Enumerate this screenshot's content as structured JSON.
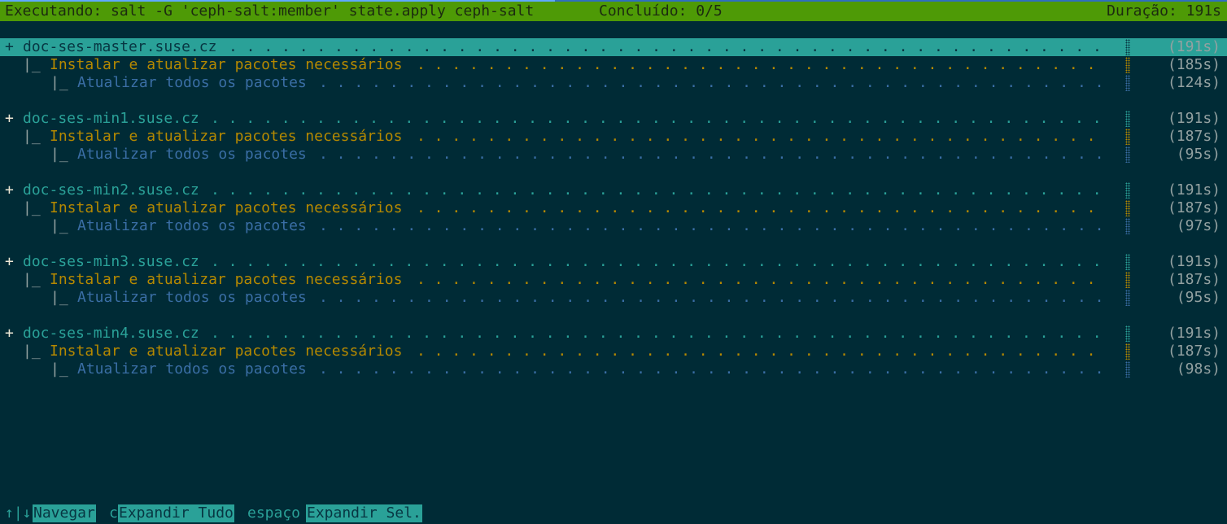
{
  "header": {
    "command": "Executando: salt -G 'ceph-salt:member' state.apply ceph-salt",
    "completed": "Concluído: 0/5",
    "duration": "Duração: 191s"
  },
  "colors": {
    "header_bg": "#4e9a06",
    "background": "#002b36",
    "host": "#2aa198",
    "task_level1": "#b58900",
    "task_level2": "#3a6ea5"
  },
  "minions": [
    {
      "expand_icon": "+",
      "host": "doc-ses-master.suse.cz",
      "time": "(191s)",
      "selected": true,
      "tasks": [
        {
          "prefix": "|_",
          "label": "Instalar e atualizar pacotes necessários",
          "time": "(185s)"
        },
        {
          "prefix": "|_",
          "label": "Atualizar todos os pacotes",
          "time": "(124s)"
        }
      ]
    },
    {
      "expand_icon": "+",
      "host": "doc-ses-min1.suse.cz",
      "time": "(191s)",
      "selected": false,
      "tasks": [
        {
          "prefix": "|_",
          "label": "Instalar e atualizar pacotes necessários",
          "time": "(187s)"
        },
        {
          "prefix": "|_",
          "label": "Atualizar todos os pacotes",
          "time": "(95s)"
        }
      ]
    },
    {
      "expand_icon": "+",
      "host": "doc-ses-min2.suse.cz",
      "time": "(191s)",
      "selected": false,
      "tasks": [
        {
          "prefix": "|_",
          "label": "Instalar e atualizar pacotes necessários",
          "time": "(187s)"
        },
        {
          "prefix": "|_",
          "label": "Atualizar todos os pacotes",
          "time": "(97s)"
        }
      ]
    },
    {
      "expand_icon": "+",
      "host": "doc-ses-min3.suse.cz",
      "time": "(191s)",
      "selected": false,
      "tasks": [
        {
          "prefix": "|_",
          "label": "Instalar e atualizar pacotes necessários",
          "time": "(187s)"
        },
        {
          "prefix": "|_",
          "label": "Atualizar todos os pacotes",
          "time": "(95s)"
        }
      ]
    },
    {
      "expand_icon": "+",
      "host": "doc-ses-min4.suse.cz",
      "time": "(191s)",
      "selected": false,
      "tasks": [
        {
          "prefix": "|_",
          "label": "Instalar e atualizar pacotes necessários",
          "time": "(187s)"
        },
        {
          "prefix": "|_",
          "label": "Atualizar todos os pacotes",
          "time": "(98s)"
        }
      ]
    }
  ],
  "footer": {
    "nav_key": "↑|↓",
    "nav_label": "Navegar",
    "expand_all_key": "c",
    "expand_all_label": "Expandir Tudo",
    "expand_sel_key": "espaço",
    "expand_sel_label": "Expandir Sel."
  }
}
